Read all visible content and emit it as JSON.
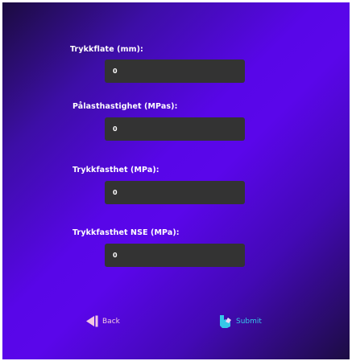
{
  "form": {
    "fields": [
      {
        "label": "Trykkflate (mm):",
        "value": "0"
      },
      {
        "label": "Pålasthastighet (MPas):",
        "value": "0"
      },
      {
        "label": "Trykkfasthet (MPa):",
        "value": "0"
      },
      {
        "label": "Trykkfasthet NSE (MPa):",
        "value": "0"
      }
    ]
  },
  "actions": {
    "back_label": "Back",
    "back_icon": "back-arrow-icon",
    "submit_label": "Submit",
    "submit_icon": "submit-hand-icon"
  },
  "colors": {
    "background_gradient": [
      "#1b0c3f",
      "#5806e8",
      "#1c0d42"
    ],
    "input_bg": "#333333",
    "back_color": "#f2c6e2",
    "submit_color": "#35c8e8"
  }
}
